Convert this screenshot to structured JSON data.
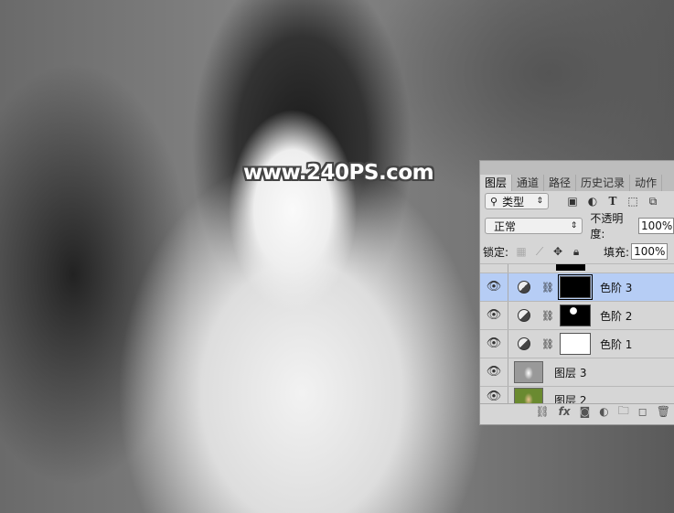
{
  "watermark": "www.240PS.com",
  "tabs": [
    "图层",
    "通道",
    "路径",
    "历史记录",
    "动作"
  ],
  "filter": {
    "label": "类型"
  },
  "blend": {
    "mode": "正常",
    "opacity_label": "不透明度:",
    "opacity": "100%"
  },
  "lock": {
    "label": "锁定:",
    "fill_label": "填充:",
    "fill": "100%"
  },
  "layers": [
    {
      "name": "色阶 3",
      "selected": true,
      "mask": "black"
    },
    {
      "name": "色阶 2",
      "selected": false,
      "mask": "black-spot"
    },
    {
      "name": "色阶 1",
      "selected": false,
      "mask": "white"
    },
    {
      "name": "图层 3",
      "type": "pixel-gray"
    },
    {
      "name": "图层 2",
      "type": "pixel-color"
    }
  ],
  "footer_icons": [
    "link-icon",
    "fx-icon",
    "mask-icon",
    "adjustment-icon",
    "folder-icon",
    "new-layer-icon",
    "trash-icon"
  ]
}
